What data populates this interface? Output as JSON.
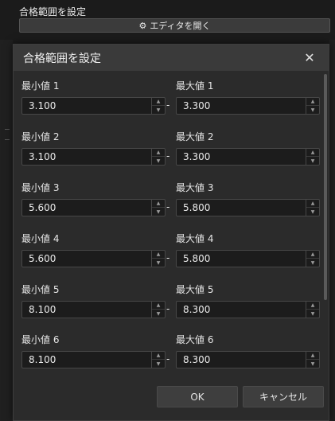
{
  "background": {
    "title": "合格範囲を設定",
    "editor_button_icon": "gear-icon",
    "editor_button_label": "エディタを開く"
  },
  "dialog": {
    "title": "合格範囲を設定",
    "close_icon": "close-icon",
    "rows": [
      {
        "min_label": "最小値 1",
        "max_label": "最大値 1",
        "min_value": "3.100",
        "max_value": "3.300"
      },
      {
        "min_label": "最小値 2",
        "max_label": "最大値 2",
        "min_value": "3.100",
        "max_value": "3.300"
      },
      {
        "min_label": "最小値 3",
        "max_label": "最大値 3",
        "min_value": "5.600",
        "max_value": "5.800"
      },
      {
        "min_label": "最小値 4",
        "max_label": "最大値 4",
        "min_value": "5.600",
        "max_value": "5.800"
      },
      {
        "min_label": "最小値 5",
        "max_label": "最大値 5",
        "min_value": "8.100",
        "max_value": "8.300"
      },
      {
        "min_label": "最小値 6",
        "max_label": "最大値 6",
        "min_value": "8.100",
        "max_value": "8.300"
      }
    ],
    "separator": "-",
    "ok_label": "OK",
    "cancel_label": "キャンセル"
  }
}
